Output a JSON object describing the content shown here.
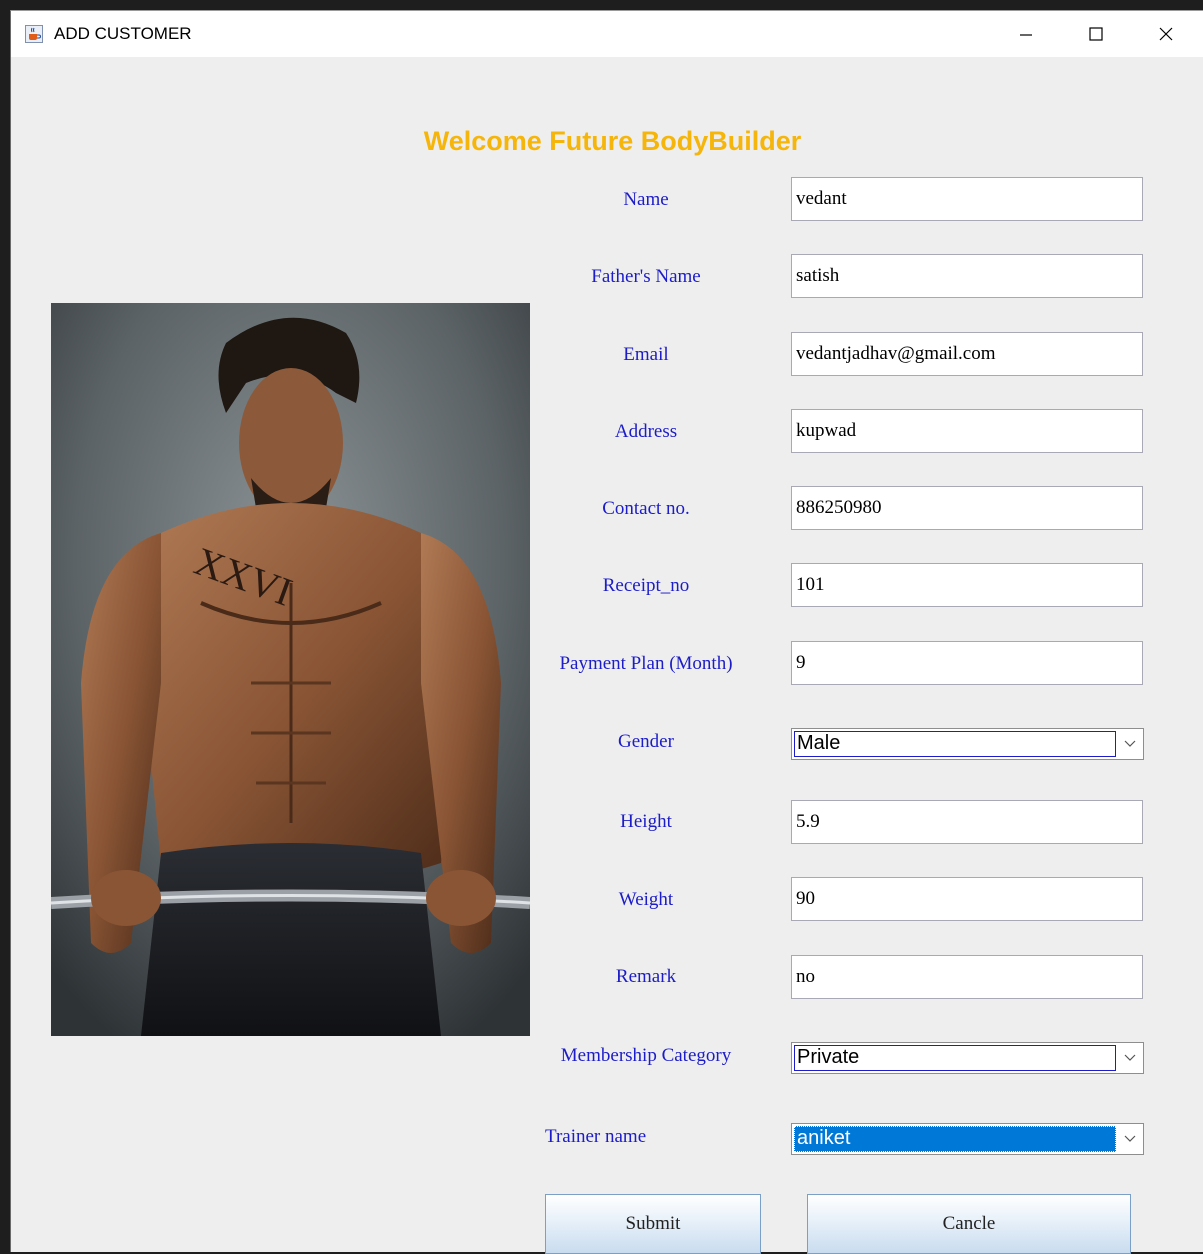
{
  "window": {
    "title": "ADD CUSTOMER"
  },
  "heading": "Welcome Future BodyBuilder",
  "colors": {
    "heading": "#f5b50a",
    "label": "#1c1cc8",
    "selection": "#0078d7"
  },
  "fields": {
    "name": {
      "label": "Name",
      "value": "vedant"
    },
    "father_name": {
      "label": "Father's Name",
      "value": "satish"
    },
    "email": {
      "label": "Email",
      "value": "vedantjadhav@gmail.com"
    },
    "address": {
      "label": "Address",
      "value": "kupwad"
    },
    "contact": {
      "label": "Contact no.",
      "value": "886250980"
    },
    "receipt": {
      "label": "Receipt_no",
      "value": "101"
    },
    "payment_plan": {
      "label": "Payment Plan (Month)",
      "value": "9"
    },
    "gender": {
      "label": "Gender",
      "value": "Male"
    },
    "height": {
      "label": "Height",
      "value": "5.9"
    },
    "weight": {
      "label": "Weight",
      "value": "90"
    },
    "remark": {
      "label": "Remark",
      "value": "no"
    },
    "membership": {
      "label": "Membership Category",
      "value": "Private"
    },
    "trainer": {
      "label": "Trainer name",
      "value": "aniket"
    }
  },
  "buttons": {
    "submit": "Submit",
    "cancel": "Cancle"
  },
  "icons": {
    "app": "java-cup-icon",
    "minimize": "minimize-icon",
    "maximize": "maximize-icon",
    "close": "close-icon",
    "dropdown": "chevron-down-icon"
  }
}
